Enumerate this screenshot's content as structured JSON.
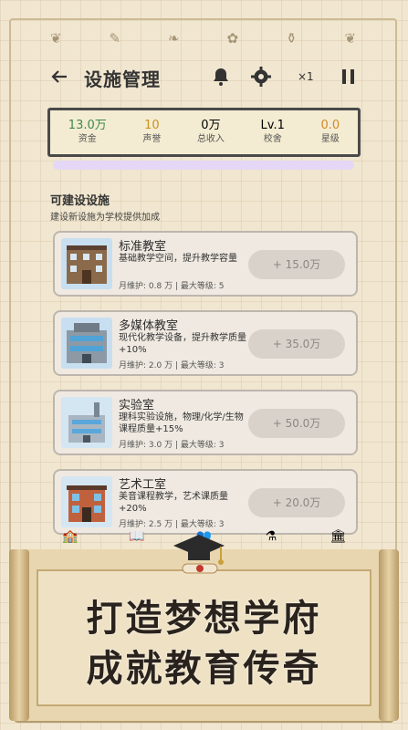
{
  "header": {
    "title": "设施管理",
    "speed": "×1"
  },
  "stats": [
    {
      "value": "13.0万",
      "label": "资金",
      "color": "#3c8a4a"
    },
    {
      "value": "10",
      "label": "声誉",
      "color": "#c89220"
    },
    {
      "value": "0万",
      "label": "总收入",
      "color": "#333333"
    },
    {
      "value": "Lv.1",
      "label": "校舍",
      "color": "#333333"
    },
    {
      "value": "0.0",
      "label": "星级",
      "color": "#d28a2a"
    }
  ],
  "section": {
    "title": "可建设设施",
    "subtitle": "建设新设施为学校提供加成"
  },
  "facilities": [
    {
      "name": "标准教室",
      "desc": "基础教学空间，提升教学容量",
      "meta": "月维护: 0.8 万 | 最大等级: 5",
      "price": "+ 15.0万"
    },
    {
      "name": "多媒体教室",
      "desc": "现代化教学设备，提升教学质量+10%",
      "meta": "月维护: 2.0 万 | 最大等级: 3",
      "price": "+ 35.0万"
    },
    {
      "name": "实验室",
      "desc": "理科实验设施，物理/化学/生物课程质量+15%",
      "meta": "月维护: 3.0 万 | 最大等级: 3",
      "price": "+ 50.0万"
    },
    {
      "name": "艺术工室",
      "desc": "美音课程教学，艺术课质量+20%",
      "meta": "月维护: 2.5 万 | 最大等级: 3",
      "price": "+ 20.0万"
    }
  ],
  "banner": {
    "line1": "打造梦想学府",
    "line2": "成就教育传奇"
  }
}
